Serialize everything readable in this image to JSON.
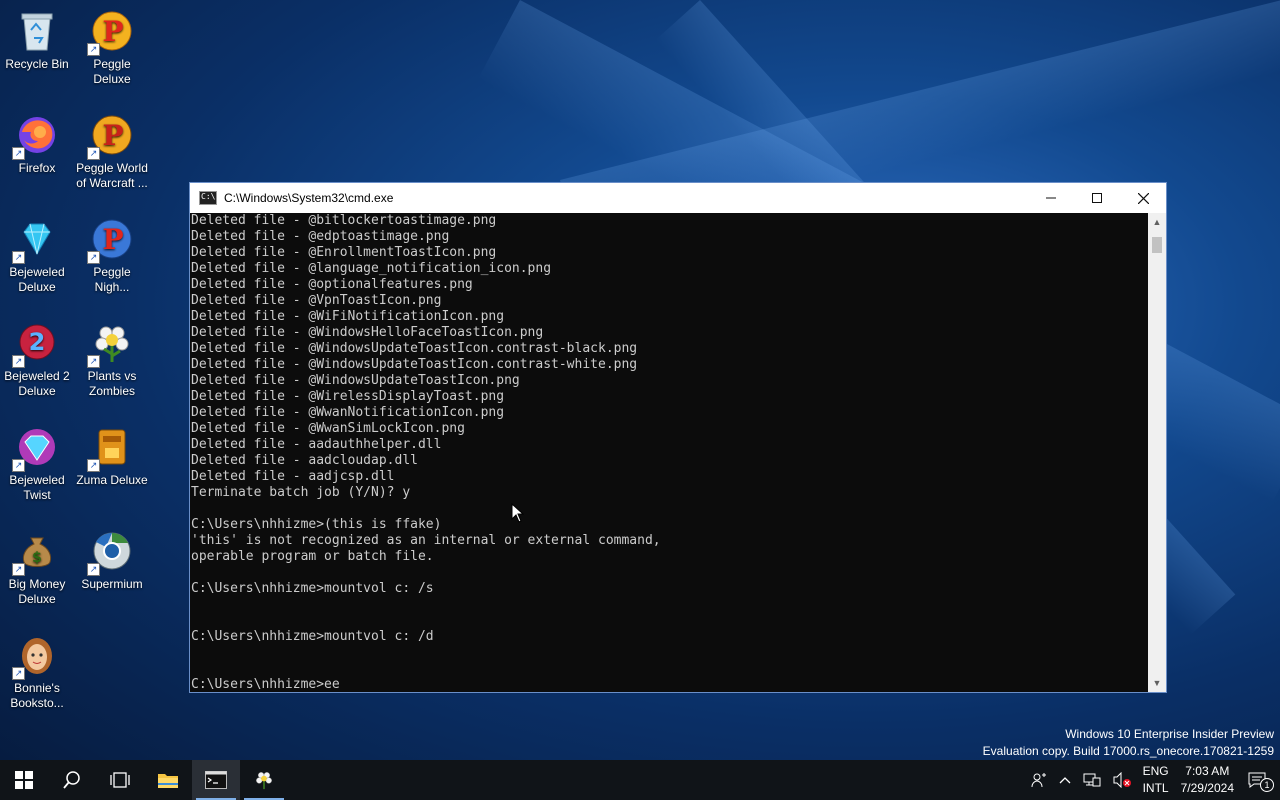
{
  "desktop": {
    "icons": [
      {
        "label": "Recycle Bin"
      },
      {
        "label": "Peggle Deluxe"
      },
      {
        "label": "Firefox"
      },
      {
        "label": "Peggle World of Warcraft ..."
      },
      {
        "label": "Bejeweled Deluxe"
      },
      {
        "label": "Peggle Nigh..."
      },
      {
        "label": "Bejeweled 2 Deluxe"
      },
      {
        "label": "Plants vs Zombies"
      },
      {
        "label": "Bejeweled Twist"
      },
      {
        "label": "Zuma Deluxe"
      },
      {
        "label": "Big Money Deluxe"
      },
      {
        "label": "Supermium"
      },
      {
        "label": "Bonnie's Booksto..."
      }
    ],
    "watermark": {
      "line1": "Windows 10 Enterprise Insider Preview",
      "line2": "Evaluation copy. Build 17000.rs_onecore.170821-1259"
    }
  },
  "cmd": {
    "title": "C:\\Windows\\System32\\cmd.exe",
    "lines": [
      "Deleted file - @bitlockertoastimage.png",
      "Deleted file - @edptoastimage.png",
      "Deleted file - @EnrollmentToastIcon.png",
      "Deleted file - @language_notification_icon.png",
      "Deleted file - @optionalfeatures.png",
      "Deleted file - @VpnToastIcon.png",
      "Deleted file - @WiFiNotificationIcon.png",
      "Deleted file - @WindowsHelloFaceToastIcon.png",
      "Deleted file - @WindowsUpdateToastIcon.contrast-black.png",
      "Deleted file - @WindowsUpdateToastIcon.contrast-white.png",
      "Deleted file - @WindowsUpdateToastIcon.png",
      "Deleted file - @WirelessDisplayToast.png",
      "Deleted file - @WwanNotificationIcon.png",
      "Deleted file - @WwanSimLockIcon.png",
      "Deleted file - aadauthhelper.dll",
      "Deleted file - aadcloudap.dll",
      "Deleted file - aadjcsp.dll",
      "Terminate batch job (Y/N)? y",
      "",
      "C:\\Users\\nhhizme>(this is ffake)",
      "'this' is not recognized as an internal or external command,",
      "operable program or batch file.",
      "",
      "C:\\Users\\nhhizme>mountvol c: /s",
      "",
      "",
      "C:\\Users\\nhhizme>mountvol c: /d",
      "",
      "",
      "C:\\Users\\nhhizme>ee"
    ]
  },
  "taskbar": {
    "language": {
      "line1": "ENG",
      "line2": "INTL"
    },
    "clock": {
      "time": "7:03 AM",
      "date": "7/29/2024"
    },
    "notification_count": "1"
  },
  "colors": {
    "console_bg": "#0c0c0c",
    "console_text": "#cccccc",
    "taskbar_bg": "#101418",
    "accent": "#7fb0e8"
  }
}
